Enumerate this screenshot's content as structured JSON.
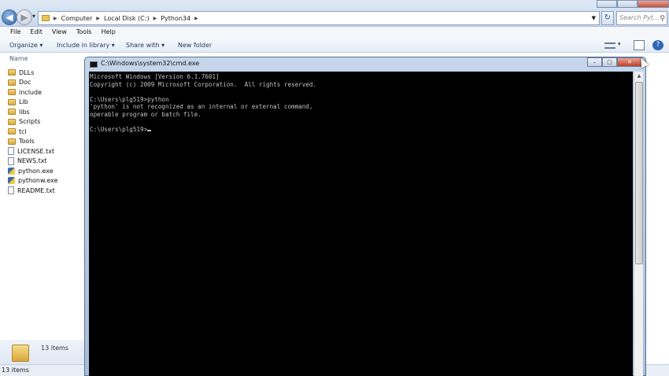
{
  "explorer": {
    "breadcrumb": [
      "Computer",
      "Local Disk (C:)",
      "Python34"
    ],
    "search_placeholder": "Search Pyt...",
    "menu": [
      "File",
      "Edit",
      "View",
      "Tools",
      "Help"
    ],
    "toolbar": {
      "organize": "Organize ▾",
      "include": "Include in library ▾",
      "share": "Share with ▾",
      "new_folder": "New folder"
    },
    "column_header": "Name",
    "files": [
      {
        "name": "DLLs",
        "type": "folder"
      },
      {
        "name": "Doc",
        "type": "folder"
      },
      {
        "name": "include",
        "type": "folder"
      },
      {
        "name": "Lib",
        "type": "folder"
      },
      {
        "name": "libs",
        "type": "folder"
      },
      {
        "name": "Scripts",
        "type": "folder"
      },
      {
        "name": "tcl",
        "type": "folder"
      },
      {
        "name": "Tools",
        "type": "folder"
      },
      {
        "name": "LICENSE.txt",
        "type": "txt"
      },
      {
        "name": "NEWS.txt",
        "type": "txt"
      },
      {
        "name": "python.exe",
        "type": "exe"
      },
      {
        "name": "pythonw.exe",
        "type": "exe"
      },
      {
        "name": "README.txt",
        "type": "txt"
      }
    ],
    "details_count": "13 items",
    "status": "13 items"
  },
  "cmd": {
    "title": "C:\\Windows\\system32\\cmd.exe",
    "lines": [
      "Microsoft Windows [Version 6.1.7601]",
      "Copyright (c) 2009 Microsoft Corporation.  All rights reserved.",
      "",
      "C:\\Users\\plg519>python",
      "'python' is not recognized as an internal or external command,",
      "operable program or batch file.",
      "",
      "C:\\Users\\plg519>"
    ]
  }
}
